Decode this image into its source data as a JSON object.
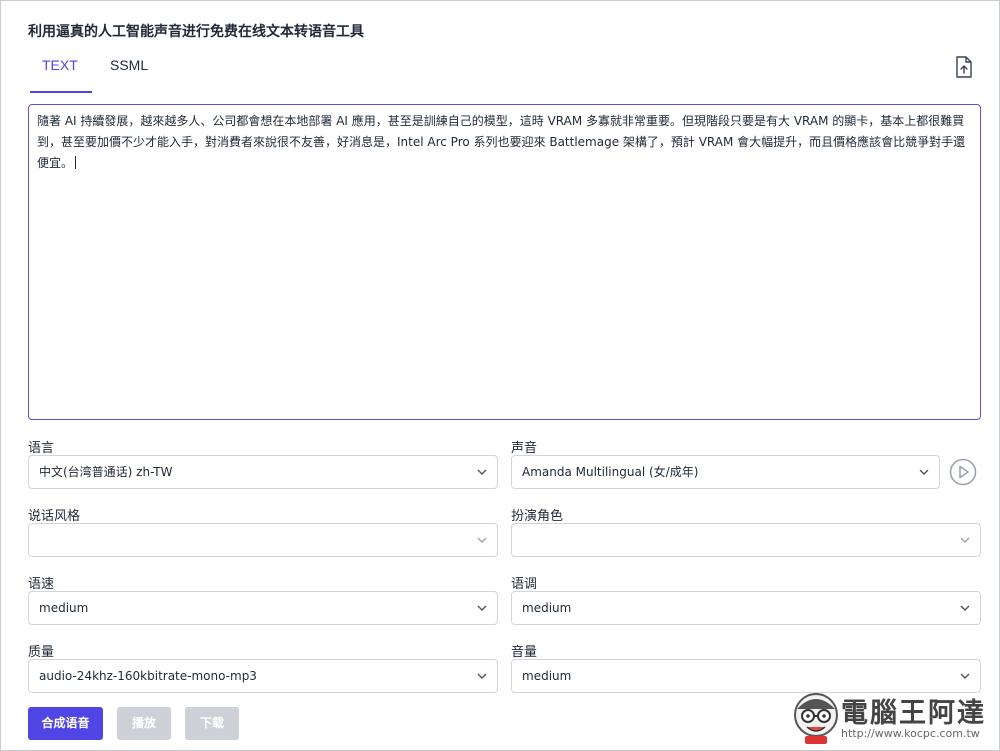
{
  "page": {
    "title": "利用逼真的人工智能声音进行免费在线文本转语音工具"
  },
  "tabs": [
    {
      "label": "TEXT",
      "active": true
    },
    {
      "label": "SSML",
      "active": false
    }
  ],
  "icons": {
    "upload": "file-upload-icon",
    "chevron": "chevron-down-icon",
    "play": "play-circle-icon"
  },
  "editor": {
    "text": "隨著 AI 持續發展，越來越多人、公司都會想在本地部署 AI 應用，甚至是訓練自己的模型，這時 VRAM 多寡就非常重要。但現階段只要是有大 VRAM 的顯卡，基本上都很難買到，甚至要加價不少才能入手，對消費者來說很不友善，好消息是，Intel Arc Pro 系列也要迎來 Battlemage 架構了，預計 VRAM 會大幅提升，而且價格應該會比競爭對手還便宜。"
  },
  "form": {
    "language": {
      "label": "语言",
      "value": "中文(台湾普通话) zh-TW"
    },
    "voice": {
      "label": "声音",
      "value": "Amanda Multilingual (女/成年)"
    },
    "style": {
      "label": "说话风格",
      "value": ""
    },
    "role": {
      "label": "扮演角色",
      "value": ""
    },
    "rate": {
      "label": "语速",
      "value": "medium"
    },
    "pitch": {
      "label": "语调",
      "value": "medium"
    },
    "quality": {
      "label": "质量",
      "value": "audio-24khz-160kbitrate-mono-mp3"
    },
    "volume": {
      "label": "音量",
      "value": "medium"
    }
  },
  "actions": {
    "synthesize": "合成语音",
    "play": "播放",
    "download": "下载"
  },
  "watermark": {
    "name": "電腦王阿達",
    "url": "http://www.kocpc.com.tw"
  },
  "colors": {
    "accent": "#4f46e5",
    "disabled": "#cdd0d6"
  }
}
